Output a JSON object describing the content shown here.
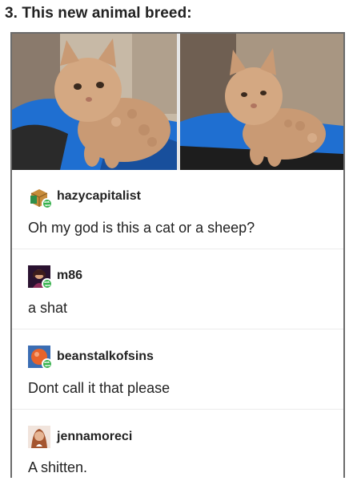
{
  "heading": "3. This new animal breed:",
  "photos": [
    {
      "subject": "curly-haired cat on blue blanket"
    },
    {
      "subject": "curly-haired cat on blue blanket"
    }
  ],
  "replies": [
    {
      "username": "hazycapitalist",
      "message": "Oh my god is this a cat or a sheep?",
      "avatar": "box-avatar-icon"
    },
    {
      "username": "m86",
      "message": "a shat",
      "avatar": "portrait-avatar-icon"
    },
    {
      "username": "beanstalkofsins",
      "message": "Dont call it that please",
      "avatar": "orange-avatar-icon"
    },
    {
      "username": "jennamoreci",
      "message": "A shitten.",
      "avatar": "selfie-avatar-icon"
    }
  ],
  "colors": {
    "reblog_badge": "#37b24d",
    "blanket": "#1f6fd1",
    "cat_fur": "#c99a74"
  }
}
